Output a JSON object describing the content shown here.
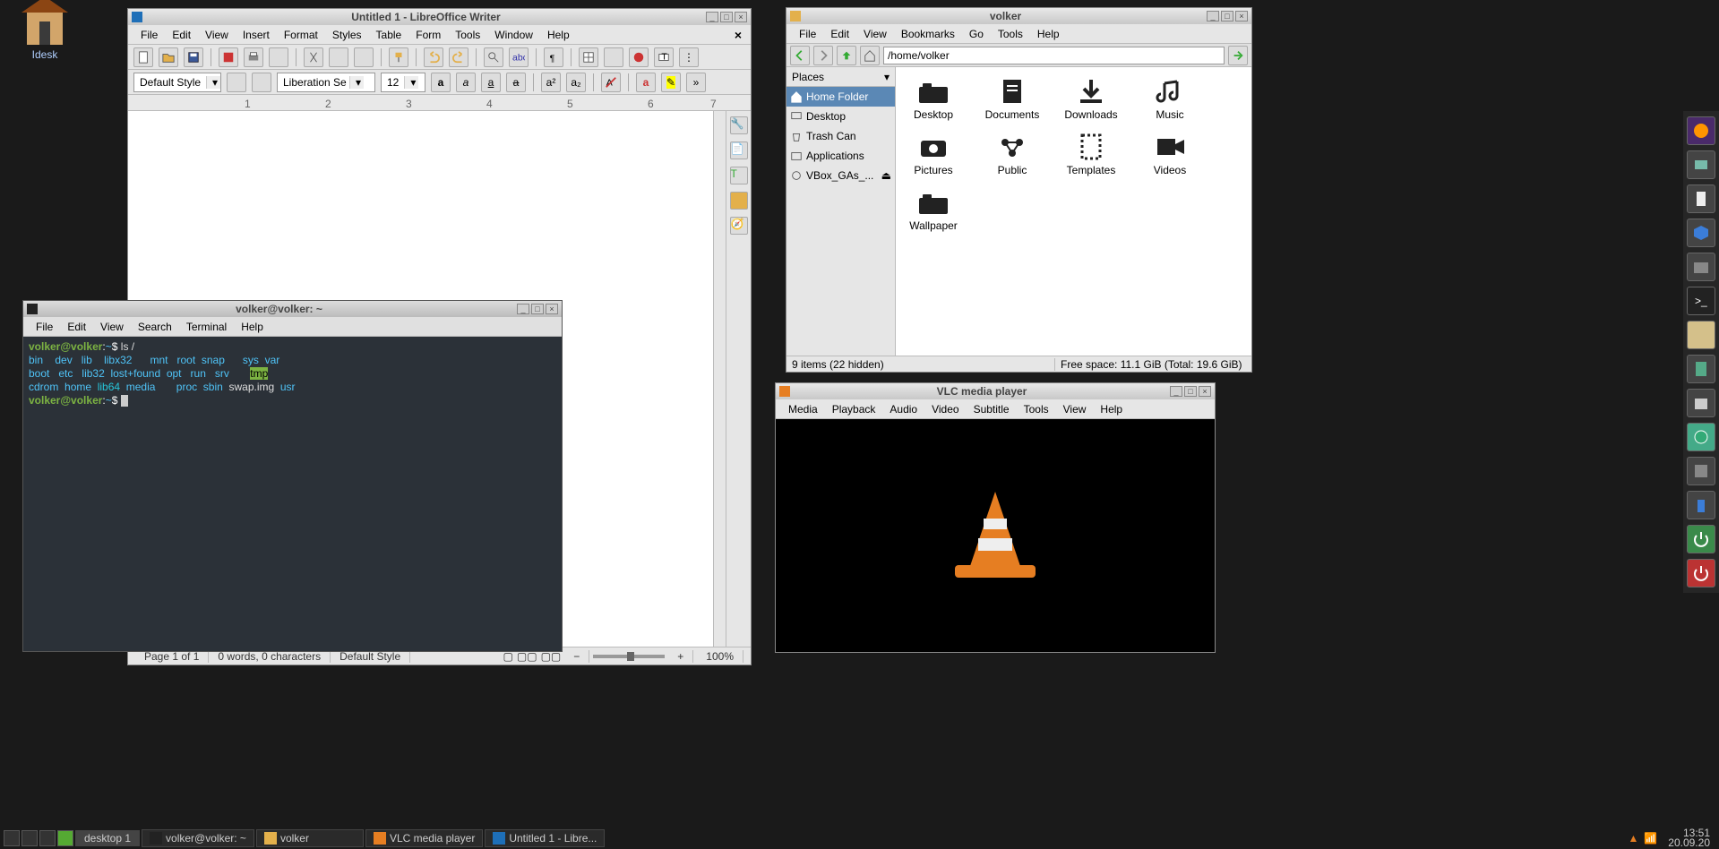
{
  "desktop": {
    "idesk_label": "Idesk"
  },
  "writer": {
    "title": "Untitled 1 - LibreOffice Writer",
    "menu": {
      "file": "File",
      "edit": "Edit",
      "view": "View",
      "insert": "Insert",
      "format": "Format",
      "styles": "Styles",
      "table": "Table",
      "form": "Form",
      "tools": "Tools",
      "window": "Window",
      "help": "Help"
    },
    "para_style": "Default Style",
    "font": "Liberation Se",
    "size": "12",
    "ruler": [
      "1",
      "2",
      "3",
      "4",
      "5",
      "6",
      "7"
    ],
    "status": {
      "page": "Page 1 of 1",
      "words": "0 words, 0 characters",
      "style": "Default Style",
      "zoom": "100%"
    }
  },
  "terminal": {
    "title": "volker@volker: ~",
    "menu": {
      "file": "File",
      "edit": "Edit",
      "view": "View",
      "search": "Search",
      "terminal": "Terminal",
      "help": "Help"
    },
    "prompt_user": "volker@volker",
    "prompt_path": "~",
    "prompt_cmd": "ls /",
    "r1": {
      "c0": "bin",
      "c1": "dev",
      "c2": "lib",
      "c3": "libx32",
      "c4": "mnt",
      "c5": "root",
      "c6": "snap",
      "c7": "sys",
      "c8": "var"
    },
    "r2": {
      "c0": "boot",
      "c1": "etc",
      "c2": "lib32",
      "c3": "lost+found",
      "c4": "opt",
      "c5": "run",
      "c6": "srv",
      "c7": "tmp"
    },
    "r3": {
      "c0": "cdrom",
      "c1": "home",
      "c2": "lib64",
      "c3": "media",
      "c4": "proc",
      "c5": "sbin",
      "c6": "swap.img",
      "c7": "usr"
    }
  },
  "fm": {
    "title": "volker",
    "menu": {
      "file": "File",
      "edit": "Edit",
      "view": "View",
      "bookmarks": "Bookmarks",
      "go": "Go",
      "tools": "Tools",
      "help": "Help"
    },
    "path": "/home/volker",
    "places_hdr": "Places",
    "places": {
      "home": "Home Folder",
      "desktop": "Desktop",
      "trash": "Trash Can",
      "apps": "Applications",
      "vbox": "VBox_GAs_..."
    },
    "items": {
      "desktop": "Desktop",
      "documents": "Documents",
      "downloads": "Downloads",
      "music": "Music",
      "pictures": "Pictures",
      "public": "Public",
      "templates": "Templates",
      "videos": "Videos",
      "wallpaper": "Wallpaper"
    },
    "status": {
      "items": "9 items (22 hidden)",
      "free": "Free space: 11.1 GiB (Total: 19.6 GiB)"
    }
  },
  "vlc": {
    "title": "VLC media player",
    "menu": {
      "media": "Media",
      "playback": "Playback",
      "audio": "Audio",
      "video": "Video",
      "subtitle": "Subtitle",
      "tools": "Tools",
      "view": "View",
      "help": "Help"
    }
  },
  "taskbar": {
    "desktop": "desktop 1",
    "t1": "volker@volker: ~",
    "t2": "volker",
    "t3": "VLC media player",
    "t4": "Untitled 1 - Libre...",
    "time": "13:51",
    "date": "20.09.20"
  }
}
